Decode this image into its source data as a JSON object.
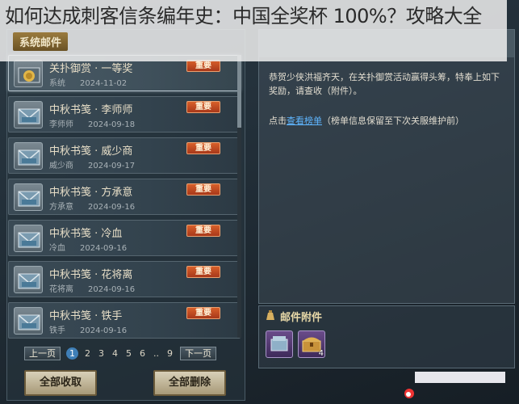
{
  "banner": {
    "title": "如何达成刺客信条编年史：中国全奖杯 100%？攻略大全"
  },
  "tab": {
    "label": "系统邮件"
  },
  "mails": [
    {
      "title": "关扑御赏 · 一等奖",
      "sender": "系统",
      "date": "2024-11-02",
      "badge": "重要",
      "icon": "gold-chest-icon"
    },
    {
      "title": "中秋书笺 · 李师师",
      "sender": "李师师",
      "date": "2024-09-18",
      "badge": "重要",
      "icon": "envelope-icon"
    },
    {
      "title": "中秋书笺 · 威少商",
      "sender": "威少商",
      "date": "2024-09-17",
      "badge": "重要",
      "icon": "envelope-icon"
    },
    {
      "title": "中秋书笺 · 方承意",
      "sender": "方承意",
      "date": "2024-09-16",
      "badge": "重要",
      "icon": "envelope-icon"
    },
    {
      "title": "中秋书笺 · 冷血",
      "sender": "冷血",
      "date": "2024-09-16",
      "badge": "重要",
      "icon": "envelope-icon"
    },
    {
      "title": "中秋书笺 · 花将离",
      "sender": "花将离",
      "date": "2024-09-16",
      "badge": "重要",
      "icon": "envelope-icon"
    },
    {
      "title": "中秋书笺 · 铁手",
      "sender": "铁手",
      "date": "2024-09-16",
      "badge": "重要",
      "icon": "envelope-icon"
    }
  ],
  "pager": {
    "prev": "上一页",
    "next": "下一页",
    "pages": [
      "1",
      "2",
      "3",
      "4",
      "5",
      "6",
      "..",
      "9"
    ],
    "current": "1"
  },
  "actions": {
    "collect_all": "全部收取",
    "delete_all": "全部删除"
  },
  "message": {
    "paragraph1": "恭贺少侠洪福齐天，在关扑御赏活动赢得头筹，特奉上如下奖励，请查收（附件）。",
    "paragraph2_prefix": "点击",
    "paragraph2_link": "查看榜单",
    "paragraph2_suffix": "（榜单信息保留至下次关服维护前）"
  },
  "attachments": {
    "title": "邮件附件",
    "items": [
      {
        "icon": "book-chest-icon",
        "count": ""
      },
      {
        "icon": "treasure-chest-icon",
        "count": "4"
      }
    ]
  },
  "colors": {
    "badge": "#c24a22",
    "link": "#5fb6ff",
    "active_page": "#3f7fb7"
  }
}
